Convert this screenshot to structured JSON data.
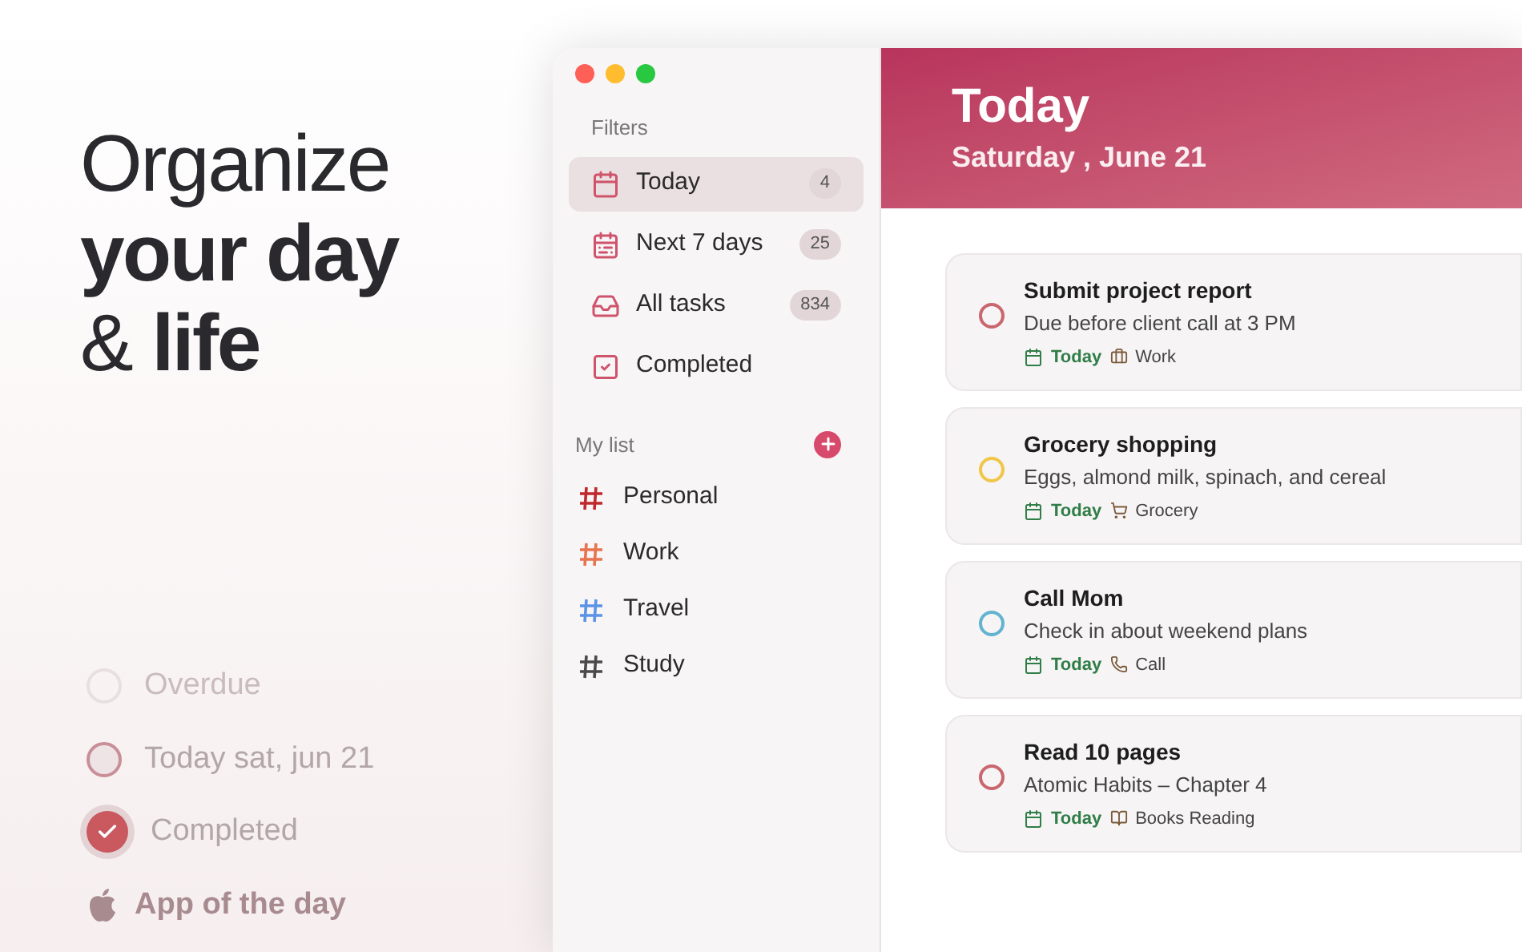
{
  "headline": [
    "Organize",
    "**your day**",
    "& **life**"
  ],
  "legend": [
    {
      "kind": "overdue",
      "label": "Overdue"
    },
    {
      "kind": "today",
      "label": "Today sat, jun 21"
    },
    {
      "kind": "completed",
      "label": "Completed"
    }
  ],
  "badge": {
    "label": "App of the day"
  },
  "sidebar": {
    "filters_title": "Filters",
    "filters": [
      {
        "kind": "today",
        "label": "Today",
        "count": "4",
        "selected": true
      },
      {
        "kind": "week",
        "label": "Next 7 days",
        "count": "25",
        "selected": false
      },
      {
        "kind": "all",
        "label": "All tasks",
        "count": "834",
        "selected": false
      },
      {
        "kind": "completed",
        "label": "Completed",
        "selected": false
      }
    ],
    "lists_title": "My list",
    "lists": [
      {
        "label": "Personal",
        "color": "#c0282d"
      },
      {
        "label": "Work",
        "color": "#e8734f"
      },
      {
        "label": "Travel",
        "color": "#5b93e6"
      },
      {
        "label": "Study",
        "color": "#4a4a4a"
      }
    ]
  },
  "header": {
    "title": "Today",
    "date": "Saturday , June 21"
  },
  "tasks": [
    {
      "title": "Submit project report",
      "note": "Due before client call at 3 PM",
      "due": "Today",
      "tag": "Work",
      "kind": "work",
      "color": "#c9666e"
    },
    {
      "title": "Grocery shopping",
      "note": "Eggs, almond milk, spinach, and cereal",
      "due": "Today",
      "tag": "Grocery",
      "kind": "grocery",
      "color": "#f0c648"
    },
    {
      "title": "Call Mom",
      "note": "Check in about weekend plans",
      "due": "Today",
      "tag": "Call",
      "kind": "call",
      "color": "#62b3cf"
    },
    {
      "title": "Read 10 pages",
      "note": "Atomic Habits – Chapter 4",
      "due": "Today",
      "tag": "Books Reading",
      "kind": "books",
      "color": "#c9666e"
    }
  ]
}
